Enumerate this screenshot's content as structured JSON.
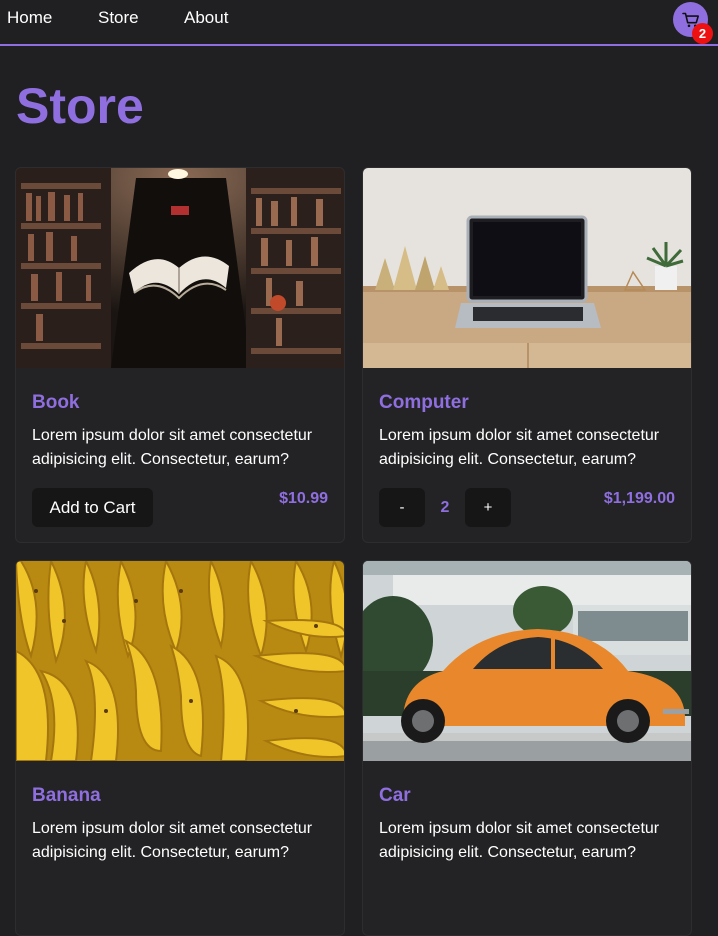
{
  "nav": {
    "links": [
      "Home",
      "Store",
      "About"
    ],
    "cart_count": "2",
    "accent": "#8f6fe0",
    "badge_color": "#ee1111"
  },
  "page": {
    "title": "Store"
  },
  "products": [
    {
      "name": "Book",
      "description": "Lorem ipsum dolor sit amet consectetur adipisicing elit. Consectetur, earum?",
      "price": "$10.99",
      "action": "Add to Cart",
      "image": "library-book-photo"
    },
    {
      "name": "Computer",
      "description": "Lorem ipsum dolor sit amet consectetur adipisicing elit. Consectetur, earum?",
      "price": "$1,199.00",
      "quantity": "2",
      "decrement": "-",
      "increment": "+",
      "image": "laptop-desk-photo"
    },
    {
      "name": "Banana",
      "description": "Lorem ipsum dolor sit amet consectetur adipisicing elit. Consectetur, earum?",
      "image": "bananas-photo"
    },
    {
      "name": "Car",
      "description": "Lorem ipsum dolor sit amet consectetur adipisicing elit. Consectetur, earum?",
      "image": "orange-beetle-car-photo"
    }
  ]
}
